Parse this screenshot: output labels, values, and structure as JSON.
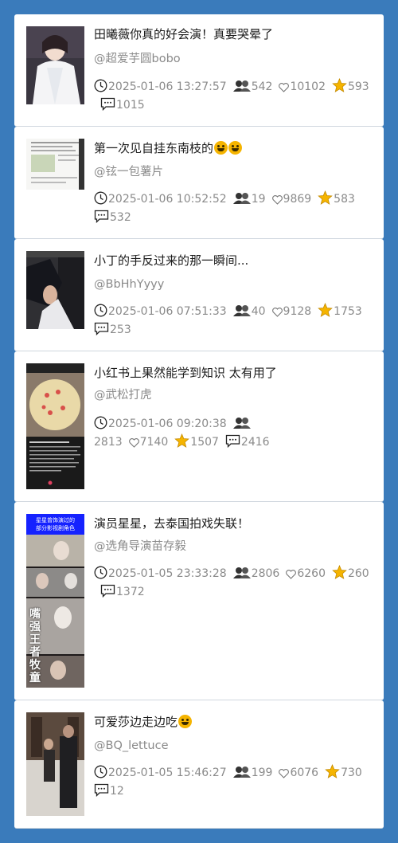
{
  "posts": [
    {
      "title": "田曦薇你真的好会演！真要哭晕了",
      "author": "@超爱芋圆bobo",
      "time": "2025-01-06 13:27:57",
      "views": "542",
      "likes": "10102",
      "stars": "593",
      "comments": "1015",
      "emoji": ""
    },
    {
      "title": "第一次见自挂东南枝的",
      "author": "@铉一包薯片",
      "time": "2025-01-06 10:52:52",
      "views": "19",
      "likes": "9869",
      "stars": "583",
      "comments": "532",
      "emoji": "sweat-smile-emoji x2"
    },
    {
      "title": "小丁的手反过来的那一瞬间...",
      "author": "@BbHhYyyy",
      "time": "2025-01-06 07:51:33",
      "views": "40",
      "likes": "9128",
      "stars": "1753",
      "comments": "253",
      "emoji": ""
    },
    {
      "title": "小红书上果然能学到知识 太有用了",
      "author": "@武松打虎",
      "time": "2025-01-06 09:20:38",
      "views": "2813",
      "likes": "7140",
      "stars": "1507",
      "comments": "2416",
      "emoji": ""
    },
    {
      "title": "演员星星，去泰国拍戏失联！",
      "author": "@选角导演苗存毅",
      "time": "2025-01-05 23:33:28",
      "views": "2806",
      "likes": "6260",
      "stars": "260",
      "comments": "1372",
      "emoji": ""
    },
    {
      "title": "可爱莎边走边吃",
      "author": "@BQ_lettuce",
      "time": "2025-01-05 15:46:27",
      "views": "199",
      "likes": "6076",
      "stars": "730",
      "comments": "12",
      "emoji": "cat-emoji"
    }
  ],
  "thumb4": {
    "banner_line1": "星星曾饰演过的",
    "banner_line2": "部分影视剧角色",
    "vertical_text": "嘴强王者牧童"
  },
  "colors": {
    "background": "#3a7bbb",
    "card": "#ffffff",
    "muted": "#8a8a8a",
    "star": "#f5b400"
  }
}
